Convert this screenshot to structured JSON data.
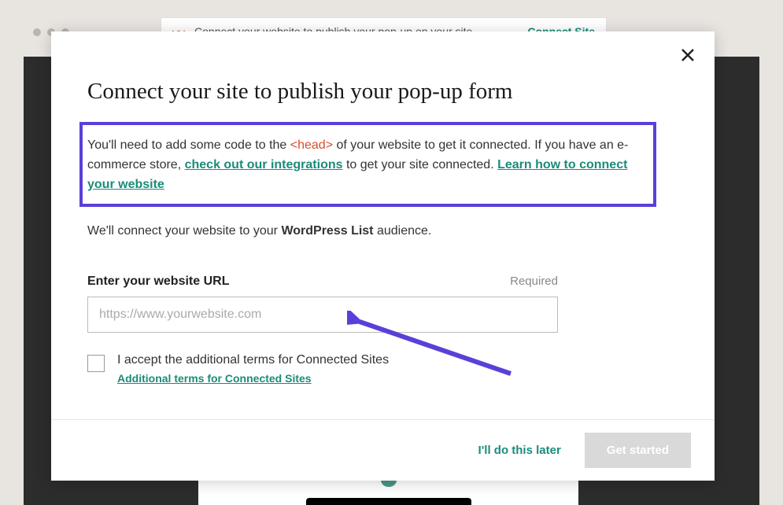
{
  "topbar": {
    "text": "Connect your website to publish your pop-up on your site",
    "link": "Connect Site"
  },
  "modal": {
    "title": "Connect your site to publish your pop-up form",
    "desc": {
      "part1": "You'll need to add some code to the ",
      "code": "<head>",
      "part2": " of your website to get it connected. If you have an e-commerce store, ",
      "link1": "check out our integrations",
      "part3": " to get your site connected. ",
      "link2": "Learn how to connect your website"
    },
    "audience": {
      "prefix": "We'll connect your website to your ",
      "name": "WordPress List",
      "suffix": " audience."
    },
    "field": {
      "label": "Enter your website URL",
      "required": "Required",
      "placeholder": "https://www.yourwebsite.com"
    },
    "terms": {
      "checkbox_label": "I accept the additional terms for Connected Sites",
      "link": "Additional terms for Connected Sites"
    },
    "footer": {
      "later": "I'll do this later",
      "start": "Get started"
    }
  }
}
